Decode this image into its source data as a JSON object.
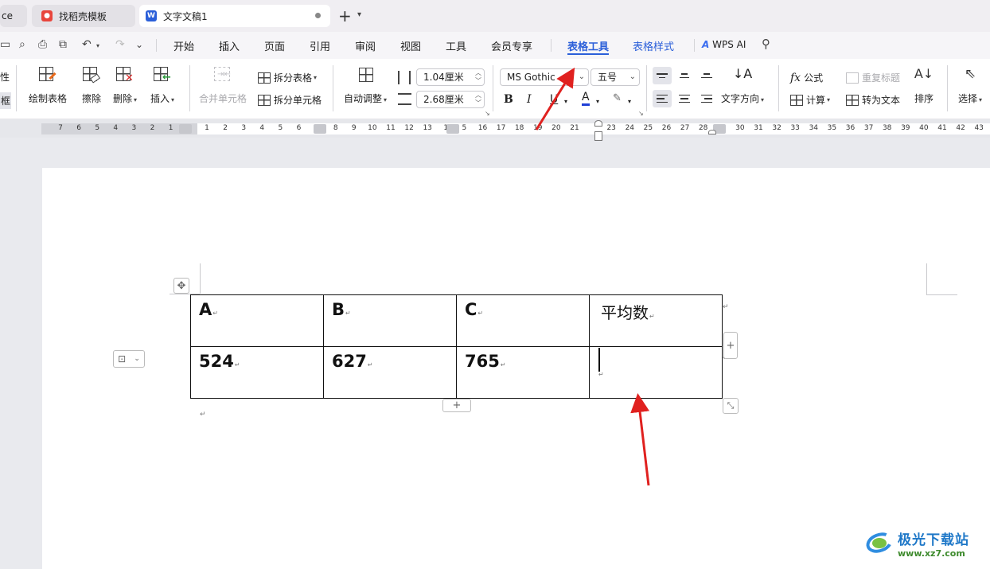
{
  "tabs": [
    {
      "label": "ce"
    },
    {
      "label": "找稻壳模板"
    },
    {
      "label": "文字文稿1"
    }
  ],
  "menu": {
    "items": [
      "开始",
      "插入",
      "页面",
      "引用",
      "审阅",
      "视图",
      "工具",
      "会员专享",
      "表格工具",
      "表格样式",
      "WPS AI"
    ],
    "active": "表格工具"
  },
  "ribbon": {
    "left_partial": [
      "性",
      "框"
    ],
    "draw_table": "绘制表格",
    "erase": "擦除",
    "delete": "删除",
    "insert": "插入",
    "merge_cells": "合并单元格",
    "split_table": "拆分表格",
    "split_cells": "拆分单元格",
    "auto_fit": "自动调整",
    "row_height": "1.04厘米",
    "col_width": "2.68厘米",
    "font_name": "MS Gothic",
    "font_size": "五号",
    "bold": "B",
    "italic": "I",
    "underline": "U",
    "font_color": "A",
    "text_direction": "文字方向",
    "formula": "公式",
    "repeat_header": "重复标题",
    "calculate": "计算",
    "to_text": "转为文本",
    "sort": "排序",
    "select": "选择"
  },
  "ruler": {
    "left_numbers": [
      "7",
      "6",
      "5",
      "4",
      "3",
      "2",
      "1"
    ],
    "right_numbers": [
      "1",
      "2",
      "3",
      "4",
      "5",
      "6",
      "8",
      "9",
      "10",
      "11",
      "12",
      "13",
      "1",
      "5",
      "16",
      "17",
      "18",
      "19",
      "20",
      "21",
      "23",
      "24",
      "25",
      "26",
      "27",
      "28",
      "30",
      "31",
      "32",
      "33",
      "34",
      "35",
      "36",
      "37",
      "38",
      "39",
      "40",
      "41",
      "42",
      "43"
    ]
  },
  "table": {
    "rows": [
      [
        "A",
        "B",
        "C",
        "平均数"
      ],
      [
        "524",
        "627",
        "765",
        ""
      ]
    ]
  },
  "watermark": {
    "name": "极光下载站",
    "url": "www.xz7.com"
  },
  "colors": {
    "accent": "#2b5fd9",
    "arrow": "#e0211f"
  }
}
